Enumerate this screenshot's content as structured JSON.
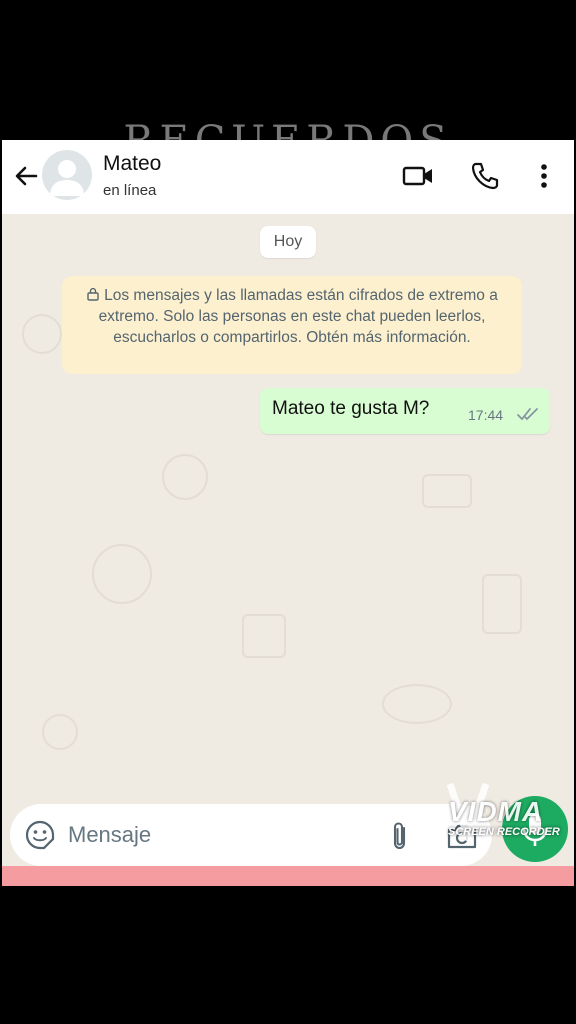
{
  "overlay": {
    "title": "RECUERDOS"
  },
  "header": {
    "contact_name": "Mateo",
    "status": "en línea",
    "icons": {
      "back": "arrow-left-icon",
      "video": "video-call-icon",
      "call": "phone-icon",
      "menu": "more-vert-icon"
    }
  },
  "chat": {
    "date_chip": "Hoy",
    "encryption_notice": "Los mensajes y las llamadas están cifrados de extremo a extremo. Solo las personas en este chat pueden leerlos, escucharlos o compartirlos. Obtén más información.",
    "messages": [
      {
        "direction": "outgoing",
        "text": "Mateo te gusta M?",
        "time": "17:44",
        "status": "read"
      }
    ]
  },
  "input": {
    "placeholder": "Mensaje",
    "icons": {
      "emoji": "sticker-icon",
      "attach": "paperclip-icon",
      "camera": "camera-icon",
      "mic": "mic-icon"
    }
  },
  "watermark": {
    "brand": "VIDMA",
    "subtitle": "SCREEN RECORDER"
  },
  "colors": {
    "header_bg": "#ffffff",
    "chat_bg": "#efeae2",
    "outgoing_bubble": "#d9fdd3",
    "notice_bg": "#fdf0cf",
    "accent_green": "#1daa61",
    "pink_strip": "#f49ca0"
  }
}
